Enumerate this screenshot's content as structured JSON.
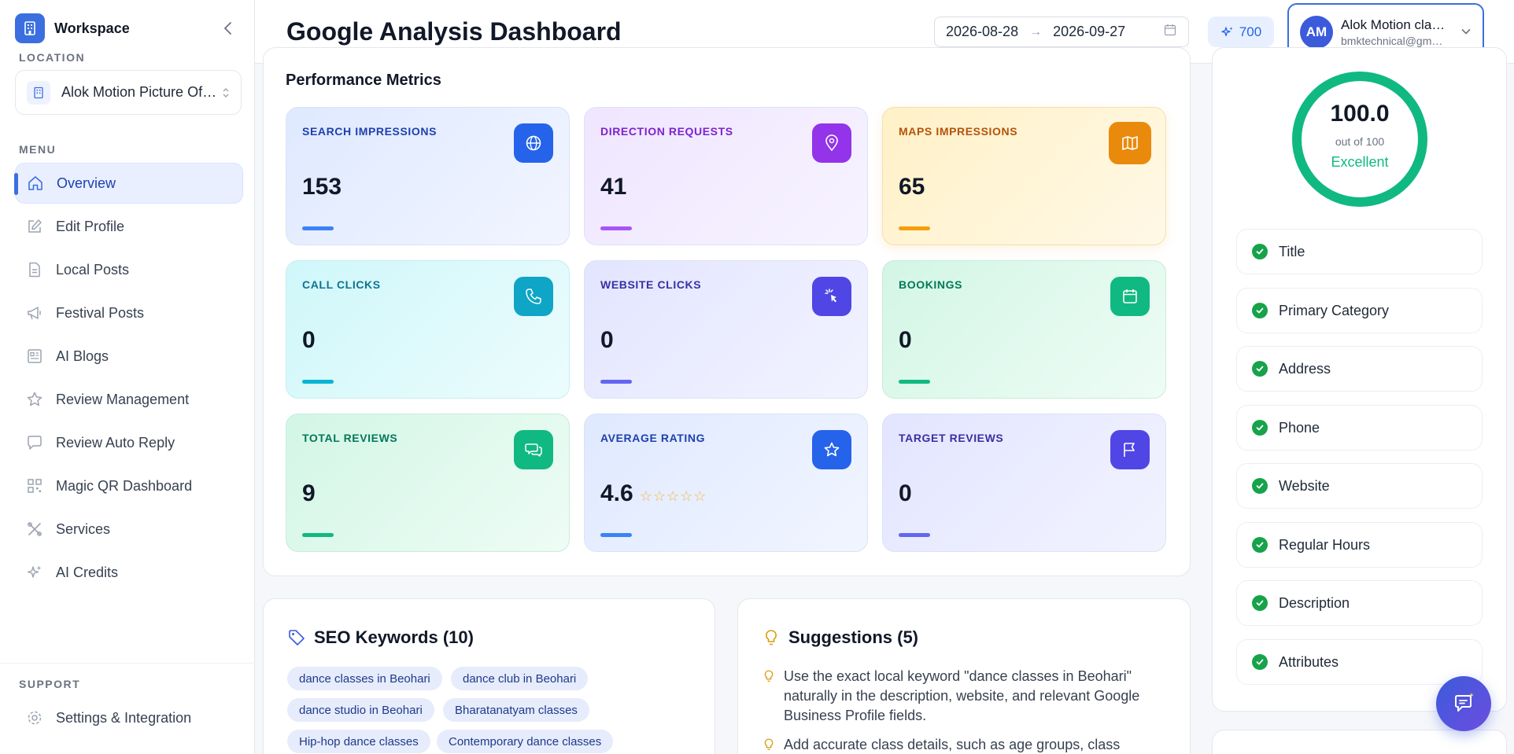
{
  "workspace": {
    "title": "Workspace"
  },
  "location": {
    "section_label": "LOCATION",
    "selected": "Alok Motion Picture Of…"
  },
  "menu": {
    "section_label": "MENU",
    "items": [
      {
        "label": "Overview",
        "icon": "home-icon",
        "active": true
      },
      {
        "label": "Edit Profile",
        "icon": "edit-icon"
      },
      {
        "label": "Local Posts",
        "icon": "document-icon"
      },
      {
        "label": "Festival Posts",
        "icon": "megaphone-icon"
      },
      {
        "label": "AI Blogs",
        "icon": "newspaper-icon"
      },
      {
        "label": "Review Management",
        "icon": "star-icon"
      },
      {
        "label": "Review Auto Reply",
        "icon": "message-icon"
      },
      {
        "label": "Magic QR Dashboard",
        "icon": "qr-icon"
      },
      {
        "label": "Services",
        "icon": "tools-icon"
      },
      {
        "label": "AI Credits",
        "icon": "sparkle-icon"
      }
    ]
  },
  "support": {
    "section_label": "SUPPORT",
    "items": [
      {
        "label": "Settings & Integration",
        "icon": "gear-icon"
      }
    ]
  },
  "header": {
    "title": "Google Analysis Dashboard",
    "date_from": "2026-08-28",
    "date_arrow": "→",
    "date_to": "2026-09-27",
    "credits": "700",
    "user": {
      "initials": "AM",
      "name": "Alok Motion cla…",
      "email": "bmktechnical@gm…"
    }
  },
  "metrics": {
    "title": "Performance Metrics",
    "cards": [
      {
        "label": "SEARCH IMPRESSIONS",
        "value": "153",
        "icon": "globe-icon"
      },
      {
        "label": "DIRECTION REQUESTS",
        "value": "41",
        "icon": "map-pin-icon"
      },
      {
        "label": "MAPS IMPRESSIONS",
        "value": "65",
        "icon": "map-icon"
      },
      {
        "label": "CALL CLICKS",
        "value": "0",
        "icon": "phone-icon"
      },
      {
        "label": "WEBSITE CLICKS",
        "value": "0",
        "icon": "cursor-click-icon"
      },
      {
        "label": "BOOKINGS",
        "value": "0",
        "icon": "calendar-icon"
      },
      {
        "label": "TOTAL REVIEWS",
        "value": "9",
        "icon": "chat-icon"
      },
      {
        "label": "AVERAGE RATING",
        "value": "4.6",
        "stars": "☆☆☆☆☆",
        "icon": "star-icon"
      },
      {
        "label": "TARGET REVIEWS",
        "value": "0",
        "icon": "flag-icon"
      }
    ],
    "colors": {
      "blue": "#2563eb",
      "purple": "#9333ea",
      "orange": "#ea8a0c",
      "cyan": "#0ea5c6",
      "indigo": "#4f46e5",
      "green": "#10b981"
    }
  },
  "seo": {
    "title": "SEO Keywords (10)",
    "keywords": [
      "dance classes in Beohari",
      "dance club in Beohari",
      "dance studio in Beohari",
      "Bharatanatyam classes",
      "Hip-hop dance classes",
      "Contemporary dance classes"
    ]
  },
  "suggestions": {
    "title": "Suggestions (5)",
    "items": [
      "Use the exact local keyword \"dance classes in Beohari\" naturally in the description, website, and relevant Google Business Profile fields.",
      "Add accurate class details, such as age groups, class"
    ]
  },
  "score": {
    "value": "100.0",
    "sub": "out of 100",
    "grade": "Excellent",
    "progress": 1.0,
    "color": "#10b981",
    "checks": [
      "Title",
      "Primary Category",
      "Address",
      "Phone",
      "Website",
      "Regular Hours",
      "Description",
      "Attributes"
    ]
  }
}
